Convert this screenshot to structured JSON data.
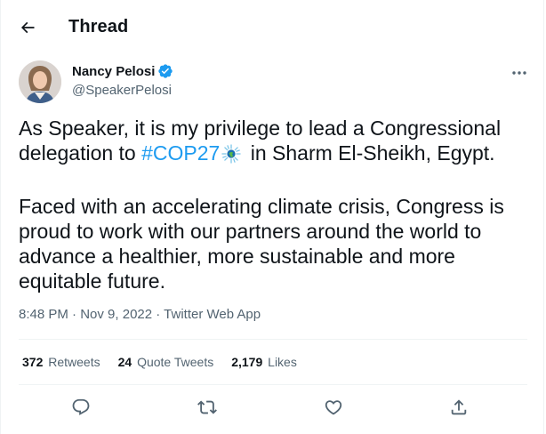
{
  "header": {
    "title": "Thread"
  },
  "author": {
    "name": "Nancy Pelosi",
    "handle": "@SpeakerPelosi",
    "verified": true
  },
  "tweet": {
    "line1_before": "As Speaker, it is my privilege to lead a Congressional delegation to ",
    "hashtag": "#COP27",
    "line1_after": " in Sharm El-Sheikh, Egypt.",
    "paragraph2": "Faced with an accelerating climate crisis, Congress is proud to work with our partners around the world to advance a healthier, more sustainable and more equitable future."
  },
  "meta": {
    "time": "8:48 PM",
    "sep1": " · ",
    "date": "Nov 9, 2022",
    "sep2": " · ",
    "source": "Twitter Web App"
  },
  "stats": {
    "retweets_count": "372",
    "retweets_label": "Retweets",
    "quotes_count": "24",
    "quotes_label": "Quote Tweets",
    "likes_count": "2,179",
    "likes_label": "Likes"
  },
  "icons": {
    "back": "arrow-left-icon",
    "verified": "verified-badge-icon",
    "more": "more-horizontal-icon",
    "reply": "reply-icon",
    "retweet": "retweet-icon",
    "like": "heart-icon",
    "share": "share-icon"
  },
  "colors": {
    "accent": "#1d9bf0",
    "text": "#0f1419",
    "secondary": "#536471",
    "divider": "#eff3f4"
  }
}
